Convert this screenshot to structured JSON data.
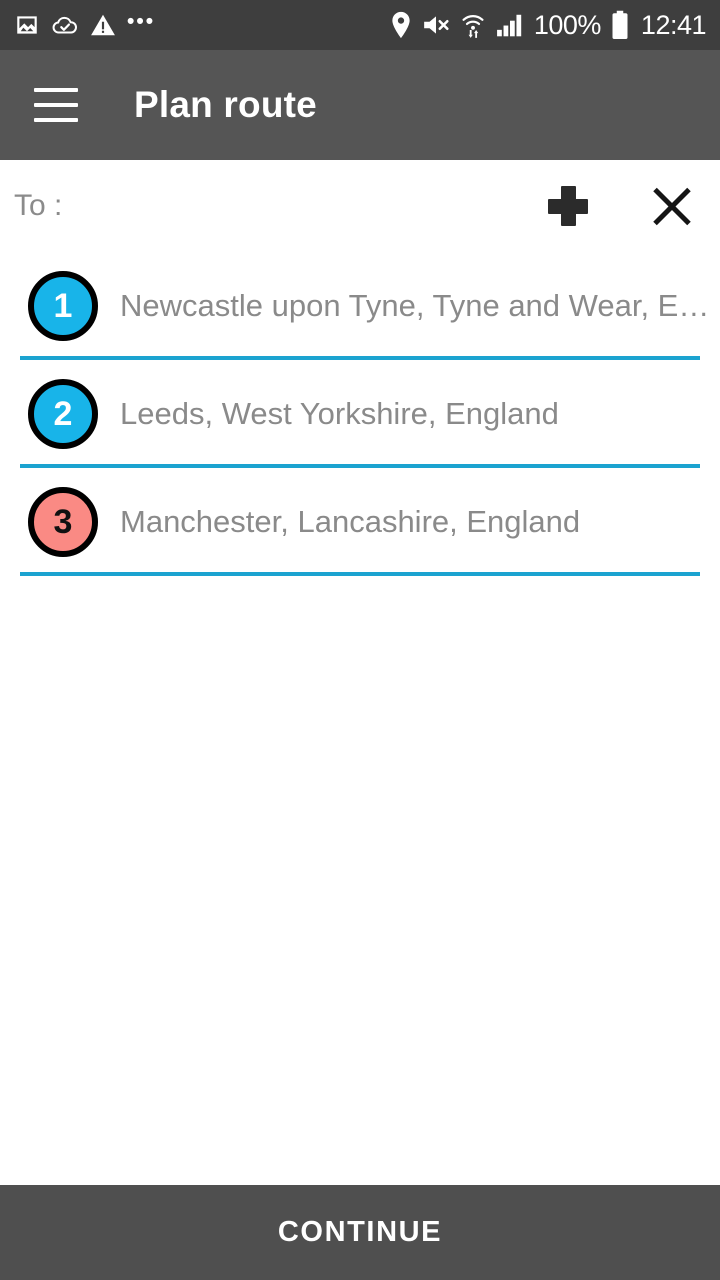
{
  "status_bar": {
    "background": "#3e3e3e",
    "left_icons": [
      {
        "name": "image-icon"
      },
      {
        "name": "cloud-check-icon"
      },
      {
        "name": "warning-triangle-icon"
      },
      {
        "name": "more-dots-icon",
        "glyph": "•••"
      }
    ],
    "right_icons": [
      {
        "name": "location-pin-icon"
      },
      {
        "name": "volume-mute-icon"
      },
      {
        "name": "wifi-transfer-icon"
      },
      {
        "name": "signal-bars-icon"
      },
      {
        "name": "battery-full-icon"
      }
    ],
    "battery_level": "100%",
    "time": "12:41"
  },
  "app_bar": {
    "background": "#555555",
    "menu_icon": "hamburger-menu-icon",
    "title": "Plan route"
  },
  "to_row": {
    "label": "To :",
    "add_icon": "plus-icon",
    "clear_icon": "close-icon"
  },
  "route_list": {
    "stops": [
      {
        "number": "1",
        "name": "Newcastle upon Tyne, Tyne and Wear, England",
        "badge_color": "#18b4e9",
        "badge_text_color": "#ffffff"
      },
      {
        "number": "2",
        "name": "Leeds, West Yorkshire, England",
        "badge_color": "#18b4e9",
        "badge_text_color": "#ffffff"
      },
      {
        "number": "3",
        "name": "Manchester, Lancashire, England",
        "badge_color": "#fa8a84",
        "badge_text_color": "#111111"
      }
    ],
    "divider_color": "#1ba3d0"
  },
  "bottom_bar": {
    "continue_label": "CONTINUE",
    "background": "#4f4f4f"
  },
  "colors": {
    "accent_blue": "#18b4e9",
    "accent_salmon": "#fa8a84",
    "divider": "#1ba3d0",
    "text_gray": "#8a8a8a",
    "dark_gray": "#555555",
    "status_gray": "#3e3e3e"
  }
}
